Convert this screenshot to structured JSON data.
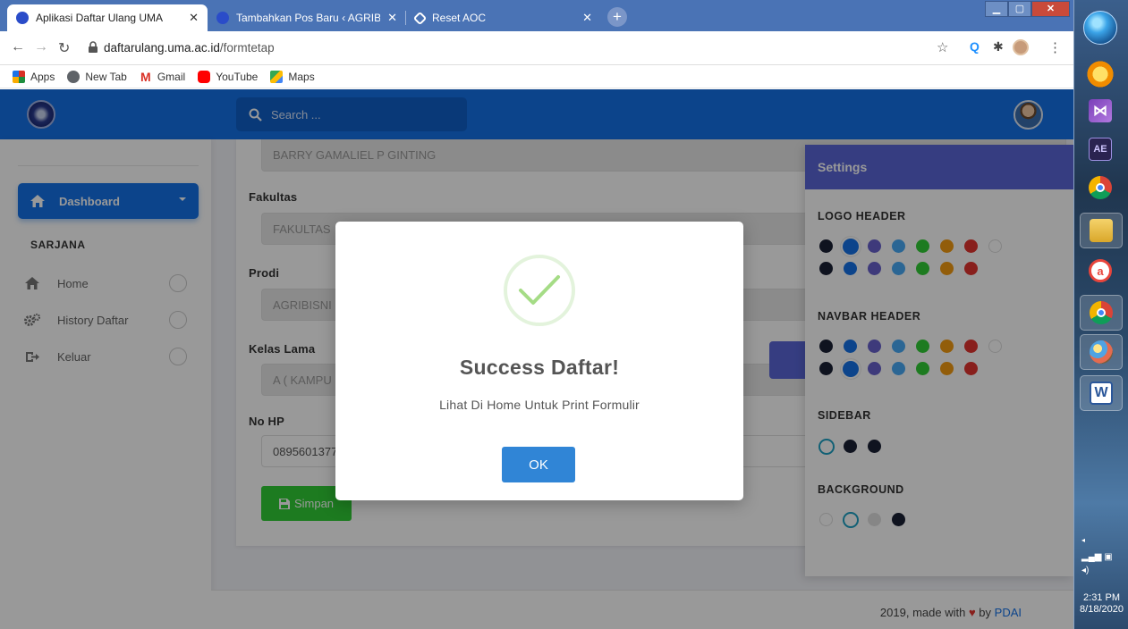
{
  "browser": {
    "tabs": [
      {
        "title": "Aplikasi Daftar Ulang UMA",
        "active": true
      },
      {
        "title": "Tambahkan Pos Baru ‹ AGRIBISNIS",
        "active": false
      },
      {
        "title": "Reset AOC",
        "active": false
      }
    ],
    "url_domain": "daftarulang.uma.ac.id",
    "url_path": "/formtetap",
    "bookmarks": [
      "Apps",
      "New Tab",
      "Gmail",
      "YouTube",
      "Maps"
    ]
  },
  "app": {
    "search": {
      "placeholder": "Search ..."
    },
    "sidebar": {
      "dashboard_label": "Dashboard",
      "section_label": "SARJANA",
      "items": [
        {
          "label": "Home",
          "icon": "home-icon"
        },
        {
          "label": "History Daftar",
          "icon": "cogs-icon"
        },
        {
          "label": "Keluar",
          "icon": "sign-out-icon"
        }
      ]
    },
    "form": {
      "nama_value": "BARRY GAMALIEL P GINTING",
      "fakultas_label": "Fakultas",
      "fakultas_value": "FAKULTAS",
      "prodi_label": "Prodi",
      "prodi_value": "AGRIBISNI",
      "kelas_label": "Kelas Lama",
      "kelas_value": "A ( KAMPU",
      "nohp_label": "No HP",
      "nohp_value": "0895601377",
      "simpan_label": "Simpan"
    },
    "settings": {
      "title": "Settings",
      "sections": {
        "logo_header": "LOGO HEADER",
        "navbar_header": "NAVBAR HEADER",
        "sidebar": "SIDEBAR",
        "background": "BACKGROUND"
      },
      "palette": [
        "#1a2035",
        "#1572e8",
        "#6861ce",
        "#48abf7",
        "#31ce36",
        "#f39c12",
        "#e3342f",
        "#ffffff"
      ]
    },
    "footer": {
      "prefix": "2019, made with",
      "heart": "♥",
      "by": "by",
      "link": "PDAI"
    }
  },
  "modal": {
    "title": "Success Daftar!",
    "text": "Lihat Di Home Untuk Print Formulir",
    "ok_label": "OK"
  },
  "taskbar": {
    "time": "2:31 PM",
    "date": "8/18/2020",
    "ae_label": "AE"
  },
  "colors": {
    "primary": "#1572e8",
    "settings_header": "#5a67d8",
    "success_green": "#31ce36",
    "ok_button": "#3085d6"
  }
}
